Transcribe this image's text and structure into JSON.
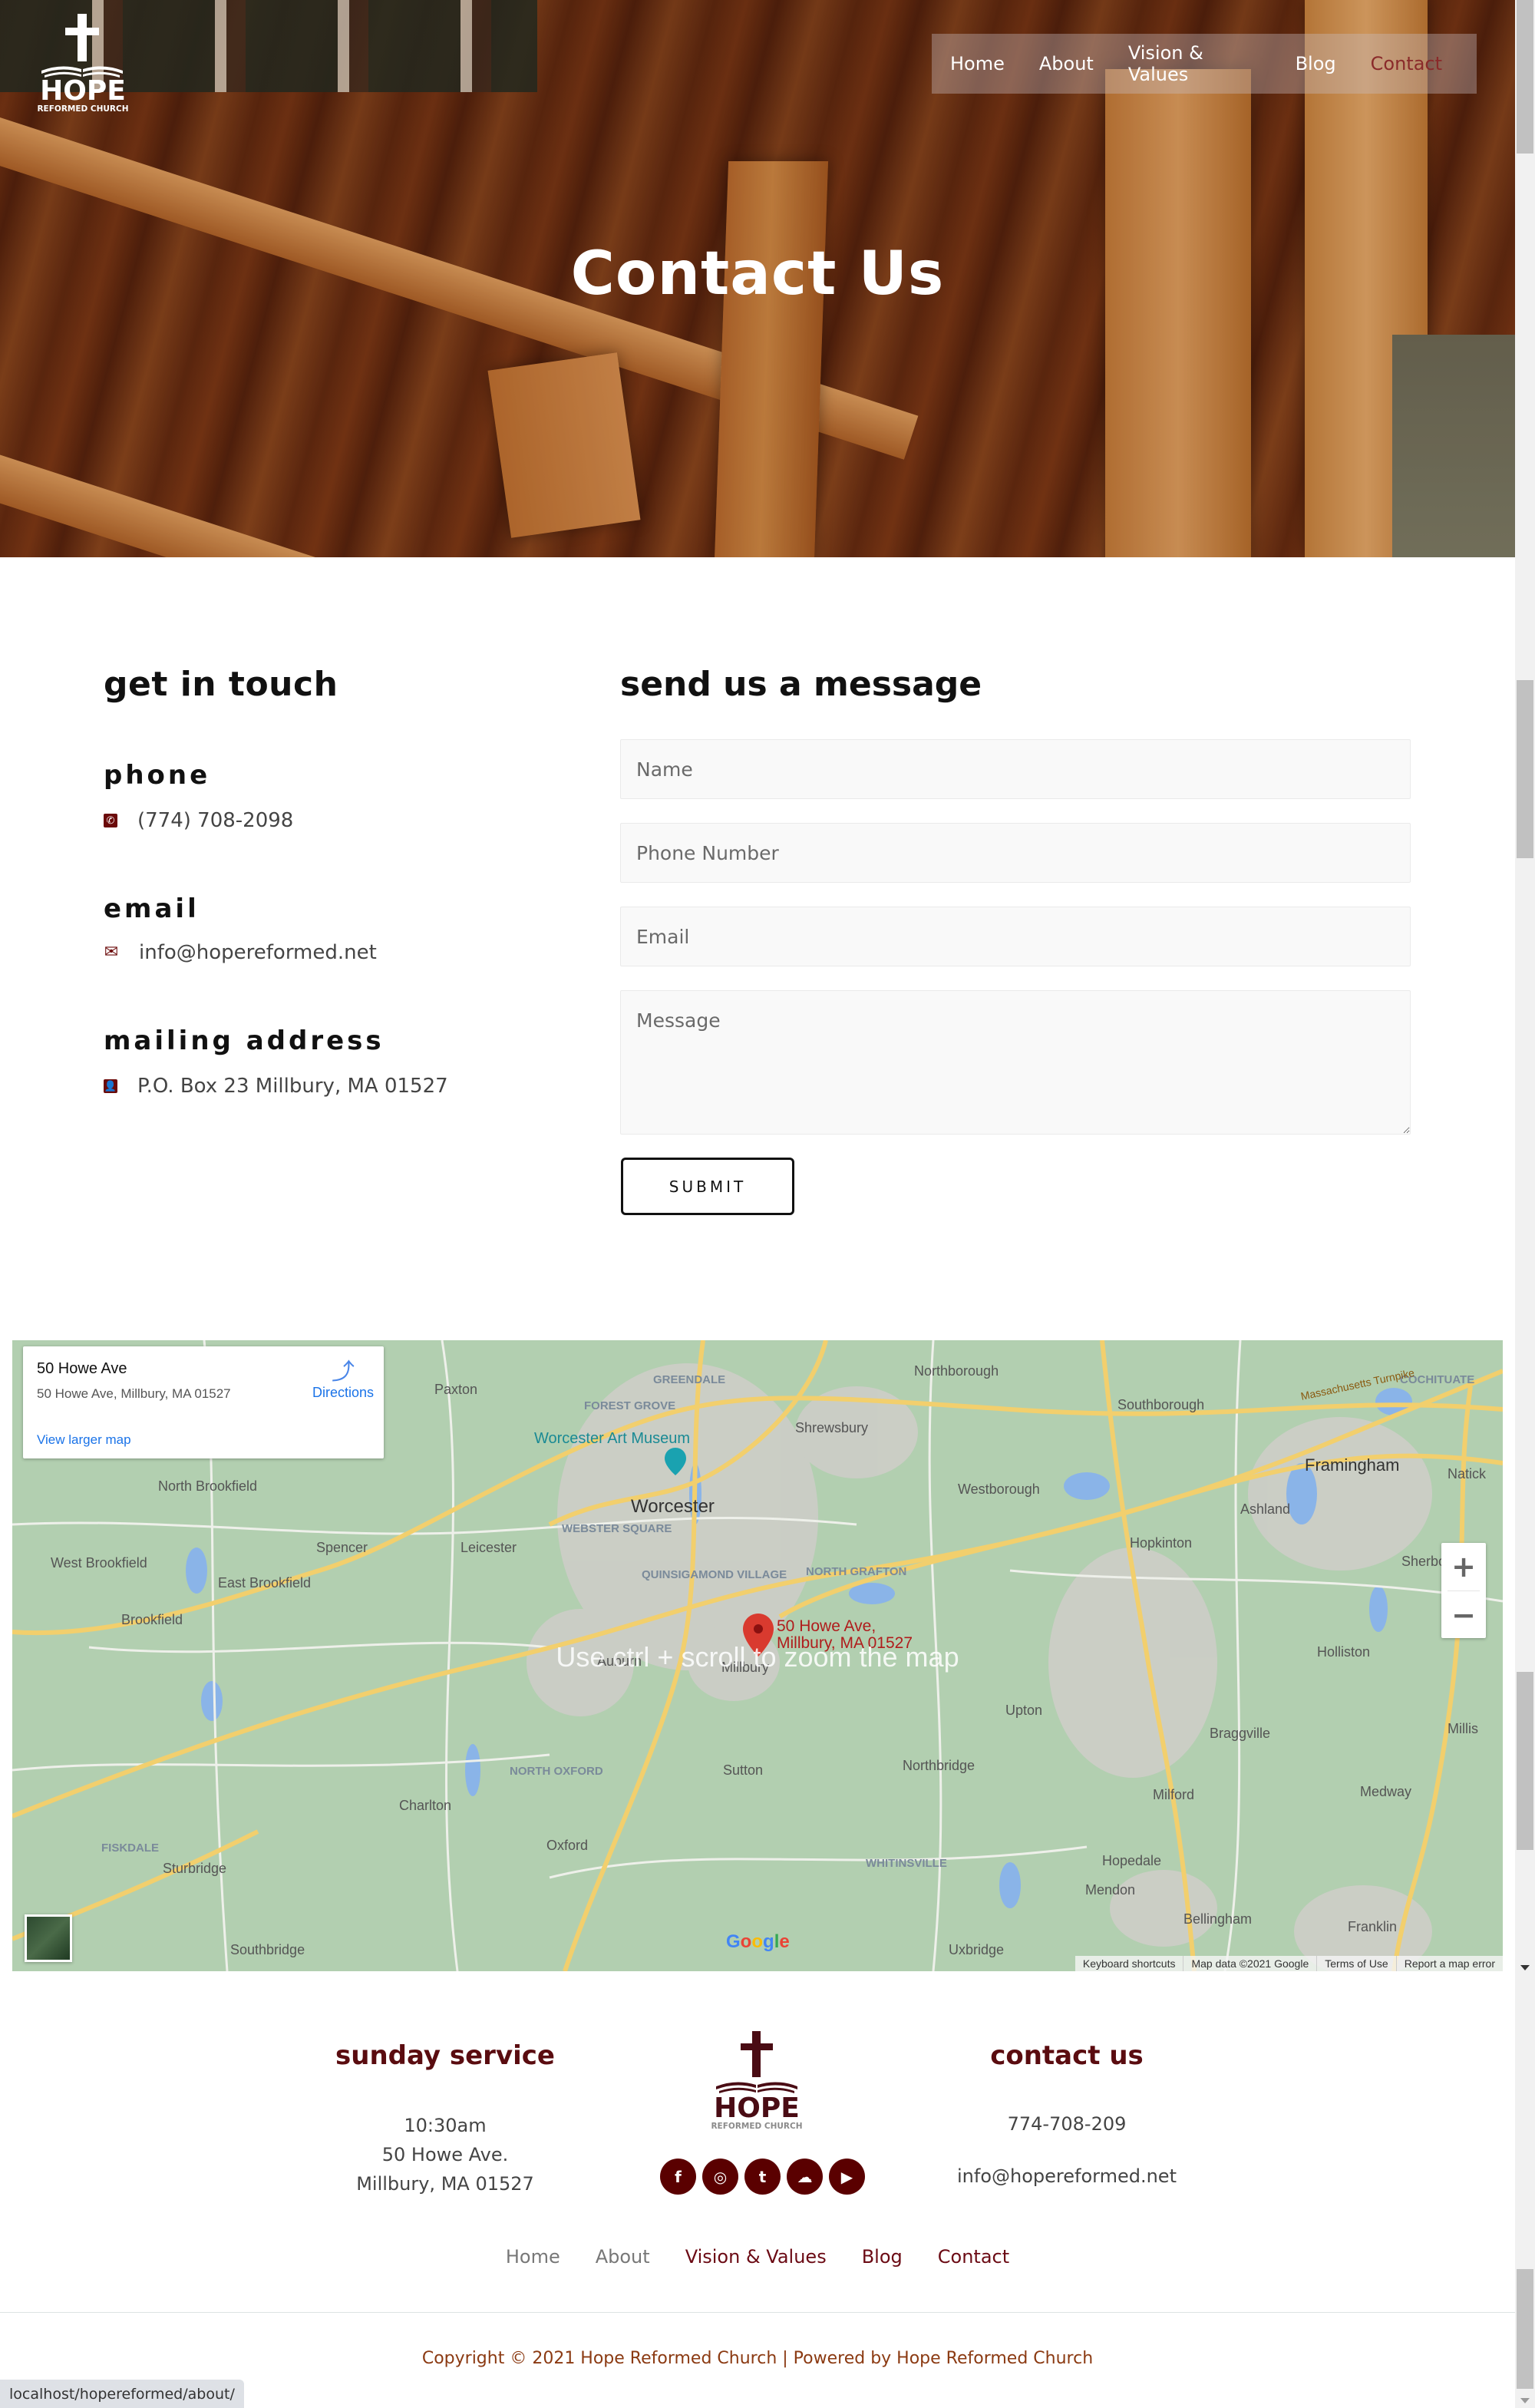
{
  "site": {
    "logo_main": "HOPE",
    "logo_sub": "REFORMED CHURCH"
  },
  "nav": {
    "items": [
      {
        "label": "Home",
        "active": false
      },
      {
        "label": "About",
        "active": false
      },
      {
        "label": "Vision & Values",
        "active": false
      },
      {
        "label": "Blog",
        "active": false
      },
      {
        "label": "Contact",
        "active": true
      }
    ]
  },
  "hero": {
    "title": "Contact Us"
  },
  "get_in_touch": {
    "title": "get in touch",
    "phone": {
      "label": "phone",
      "icon": "phone-square-icon",
      "value": "(774) 708-2098"
    },
    "email": {
      "label": "email",
      "icon": "envelope-icon",
      "value": "info@hopereformed.net"
    },
    "address": {
      "label": "mailing address",
      "icon": "address-book-icon",
      "value": "P.O. Box 23 Millbury, MA 01527"
    }
  },
  "form": {
    "title": "send us a message",
    "name_placeholder": "Name",
    "phone_placeholder": "Phone Number",
    "email_placeholder": "Email",
    "message_placeholder": "Message",
    "name_value": "",
    "phone_value": "",
    "email_value": "",
    "message_value": "",
    "submit_label": "SUBMIT"
  },
  "map": {
    "card_title": "50 Howe Ave",
    "card_address": "50 Howe Ave, Millbury, MA 01527",
    "directions_label": "Directions",
    "view_larger_label": "View larger map",
    "pin_label_line1": "50 Howe Ave,",
    "pin_label_line2": "Millbury, MA 01527",
    "hint": "Use ctrl + scroll to zoom the map",
    "zoom_in": "+",
    "zoom_out": "−",
    "google_logo": "Google",
    "footer_links": [
      "Keyboard shortcuts",
      "Map data ©2021 Google",
      "Terms of Use",
      "Report a map error"
    ],
    "poi": "Worcester Art Museum",
    "places": [
      {
        "name": "Worcester",
        "kind": "city"
      },
      {
        "name": "Paxton",
        "kind": "town"
      },
      {
        "name": "FOREST GROVE",
        "kind": "district"
      },
      {
        "name": "GREENDALE",
        "kind": "district"
      },
      {
        "name": "Shrewsbury",
        "kind": "town"
      },
      {
        "name": "Northborough",
        "kind": "town"
      },
      {
        "name": "Southborough",
        "kind": "town"
      },
      {
        "name": "COCHITUATE",
        "kind": "district"
      },
      {
        "name": "Framingham",
        "kind": "city"
      },
      {
        "name": "Natick",
        "kind": "town"
      },
      {
        "name": "Ashland",
        "kind": "town"
      },
      {
        "name": "Westborough",
        "kind": "town"
      },
      {
        "name": "Sherborn",
        "kind": "town"
      },
      {
        "name": "North Brookfield",
        "kind": "town"
      },
      {
        "name": "Spencer",
        "kind": "town"
      },
      {
        "name": "Leicester",
        "kind": "town"
      },
      {
        "name": "WEBSTER SQUARE",
        "kind": "district"
      },
      {
        "name": "West Brookfield",
        "kind": "town"
      },
      {
        "name": "East Brookfield",
        "kind": "town"
      },
      {
        "name": "Brookfield",
        "kind": "town"
      },
      {
        "name": "QUINSIGAMOND VILLAGE",
        "kind": "district"
      },
      {
        "name": "NORTH GRAFTON",
        "kind": "district"
      },
      {
        "name": "Hopkinton",
        "kind": "town"
      },
      {
        "name": "Holliston",
        "kind": "town"
      },
      {
        "name": "Millis",
        "kind": "town"
      },
      {
        "name": "Auburn",
        "kind": "town"
      },
      {
        "name": "Millbury",
        "kind": "town"
      },
      {
        "name": "Upton",
        "kind": "town"
      },
      {
        "name": "Braggville",
        "kind": "town"
      },
      {
        "name": "Medway",
        "kind": "town"
      },
      {
        "name": "NORTH OXFORD",
        "kind": "district"
      },
      {
        "name": "Sutton",
        "kind": "town"
      },
      {
        "name": "Northbridge",
        "kind": "town"
      },
      {
        "name": "Milford",
        "kind": "town"
      },
      {
        "name": "Charlton",
        "kind": "town"
      },
      {
        "name": "Hopedale",
        "kind": "town"
      },
      {
        "name": "FISKDALE",
        "kind": "district"
      },
      {
        "name": "Oxford",
        "kind": "town"
      },
      {
        "name": "WHITINSVILLE",
        "kind": "district"
      },
      {
        "name": "Sturbridge",
        "kind": "town"
      },
      {
        "name": "Mendon",
        "kind": "town"
      },
      {
        "name": "Bellingham",
        "kind": "town"
      },
      {
        "name": "Franklin",
        "kind": "town"
      },
      {
        "name": "Southbridge",
        "kind": "town"
      },
      {
        "name": "Uxbridge",
        "kind": "town"
      }
    ],
    "road_label": "Massachusetts Turnpike"
  },
  "footer": {
    "service_title": "sunday service",
    "service_lines": [
      "10:30am",
      "50 Howe Ave.",
      "Millbury, MA 01527"
    ],
    "contact_title": "contact us",
    "contact_phone": "774-708-209",
    "contact_email": "info@hopereformed.net",
    "social": [
      {
        "name": "facebook",
        "glyph": "f"
      },
      {
        "name": "instagram",
        "glyph": "◎"
      },
      {
        "name": "twitter",
        "glyph": "t"
      },
      {
        "name": "soundcloud",
        "glyph": "☁"
      },
      {
        "name": "youtube",
        "glyph": "▶"
      }
    ],
    "nav": [
      "Home",
      "About",
      "Vision & Values",
      "Blog",
      "Contact"
    ],
    "copyright": "Copyright © 2021 Hope Reformed Church | Powered by Hope Reformed Church"
  },
  "browser": {
    "status_url": "localhost/hopereformed/about/"
  },
  "colors": {
    "brand": "#5a0c10",
    "accent_nav_active": "#8a2a2a",
    "link_blue": "#1a73e8",
    "copyright": "#8b3a12"
  }
}
